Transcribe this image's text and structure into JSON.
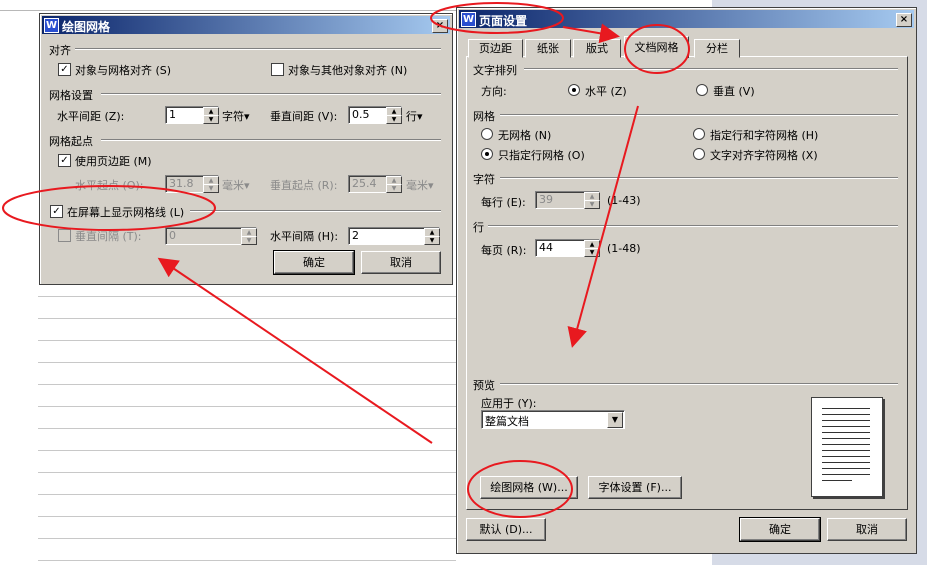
{
  "grid_dialog": {
    "title": "绘图网格",
    "close_glyph": "×",
    "align_section": "对齐",
    "snap_to_grid": "对象与网格对齐 (S)",
    "snap_to_grid_checked": true,
    "snap_to_objects": "对象与其他对象对齐 (N)",
    "snap_to_objects_checked": false,
    "grid_settings_section": "网格设置",
    "h_spacing_label": "水平间距 (Z):",
    "h_spacing_value": "1",
    "h_spacing_unit": "字符▾",
    "v_spacing_label": "垂直间距 (V):",
    "v_spacing_value": "0.5",
    "v_spacing_unit": "行▾",
    "origin_section": "网格起点",
    "use_margins": "使用页边距 (M)",
    "use_margins_checked": true,
    "h_origin_label": "水平起点 (O):",
    "h_origin_value": "31.8",
    "h_origin_unit": "毫米▾",
    "v_origin_label": "垂直起点 (R):",
    "v_origin_value": "25.4",
    "v_origin_unit": "毫米▾",
    "show_gridlines": "在屏幕上显示网格线 (L)",
    "show_gridlines_checked": true,
    "v_interval_label": "垂直间隔 (T):",
    "v_interval_value": "0",
    "h_interval_label": "水平间隔 (H):",
    "h_interval_value": "2",
    "ok": "确定",
    "cancel": "取消"
  },
  "page_dialog": {
    "title": "页面设置",
    "close_glyph": "×",
    "tabs": [
      "页边距",
      "纸张",
      "版式",
      "文档网格",
      "分栏"
    ],
    "active_tab": "文档网格",
    "text_direction_section": "文字排列",
    "direction_label": "方向:",
    "horizontal": "水平 (Z)",
    "vertical": "垂直 (V)",
    "grid_section": "网格",
    "no_grid": "无网格 (N)",
    "lines_and_chars": "指定行和字符网格 (H)",
    "lines_only": "只指定行网格 (O)",
    "snap_chars": "文字对齐字符网格 (X)",
    "chars_section": "字符",
    "per_line_label": "每行 (E):",
    "per_line_value": "39",
    "per_line_range": "(1-43)",
    "lines_section": "行",
    "per_page_label": "每页 (R):",
    "per_page_value": "44",
    "per_page_range": "(1-48)",
    "preview_section": "预览",
    "apply_to_label": "应用于 (Y):",
    "apply_to_value": "整篇文档",
    "drawing_grid_button": "绘图网格 (W)...",
    "font_settings_button": "字体设置 (F)...",
    "default_button": "默认 (D)...",
    "ok": "确定",
    "cancel": "取消"
  },
  "annotation_color": "#e8191f"
}
